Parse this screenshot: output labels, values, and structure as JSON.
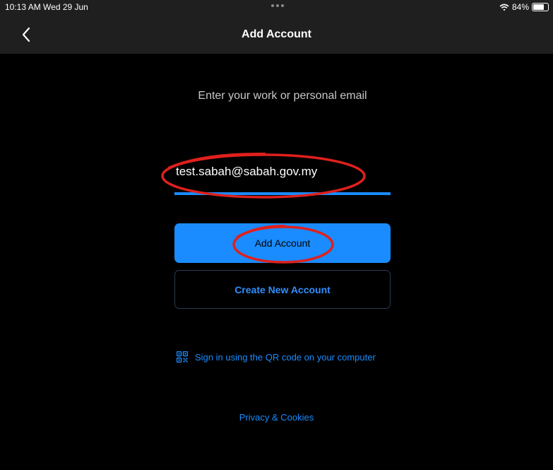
{
  "status_bar": {
    "time": "10:13 AM  Wed 29 Jun",
    "battery_text": "84%",
    "battery_level": 0.84
  },
  "nav": {
    "title": "Add Account",
    "back_icon": "chevron-left-icon"
  },
  "form": {
    "prompt": "Enter your work or personal email",
    "email_value": "test.sabah@sabah.gov.my",
    "add_account_label": "Add Account",
    "create_account_label": "Create New Account"
  },
  "links": {
    "qr_text": "Sign in using the QR code on your computer",
    "qr_icon": "qr-code-icon",
    "privacy_text": "Privacy & Cookies"
  },
  "colors": {
    "accent": "#1a8cff",
    "background": "#000000",
    "bar": "#1f1f1f",
    "annotation": "#e0201c"
  }
}
